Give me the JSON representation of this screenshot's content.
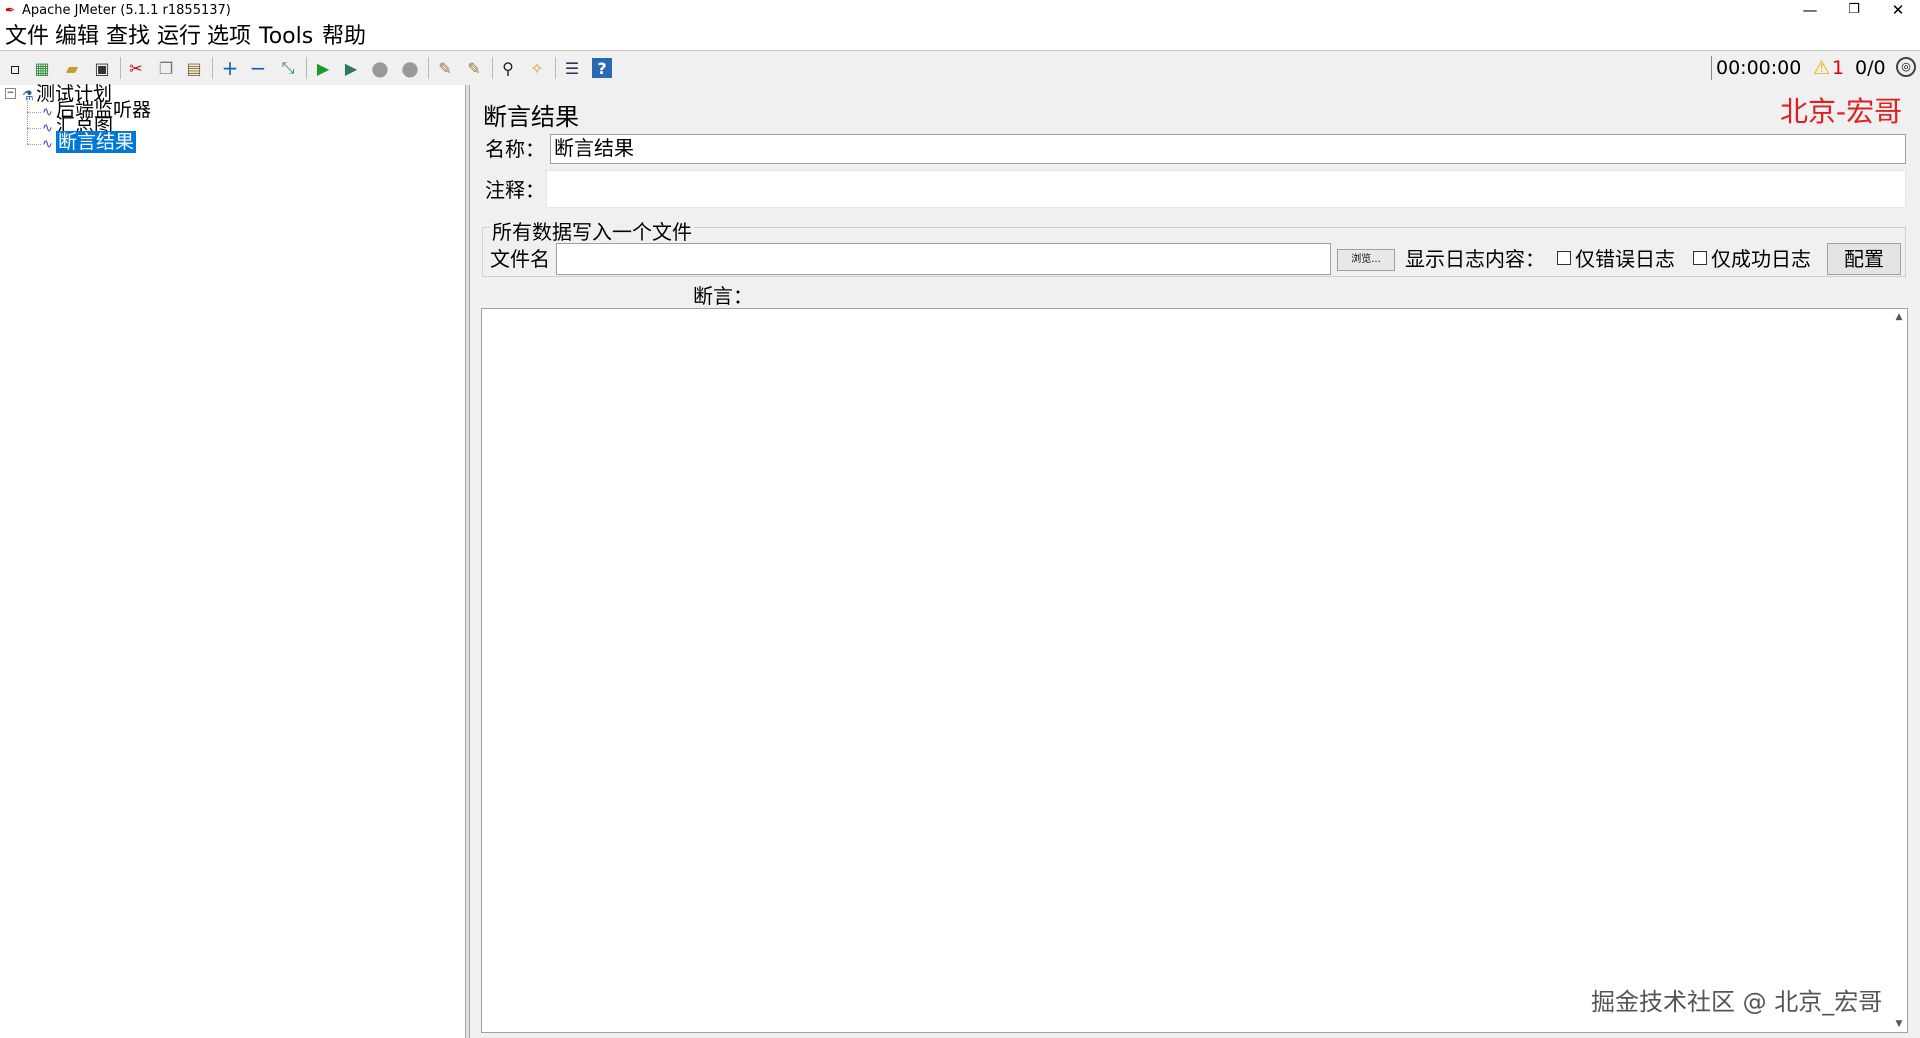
{
  "window": {
    "title": "Apache JMeter (5.1.1 r1855137)",
    "minimize_glyph": "—",
    "restore_glyph": "❐",
    "close_glyph": "✕"
  },
  "menu": [
    "文件",
    "编辑",
    "查找",
    "运行",
    "选项",
    "Tools",
    "帮助"
  ],
  "toolbar": {
    "icons": [
      {
        "name": "new-icon",
        "glyph": "▫"
      },
      {
        "name": "templates-icon",
        "glyph": "▦"
      },
      {
        "name": "open-icon",
        "glyph": "▰"
      },
      {
        "name": "save-icon",
        "glyph": "▣"
      },
      {
        "name": "cut-icon",
        "glyph": "✂"
      },
      {
        "name": "copy-icon",
        "glyph": "❐"
      },
      {
        "name": "paste-icon",
        "glyph": "▤"
      },
      {
        "name": "expand-icon",
        "glyph": "+"
      },
      {
        "name": "collapse-icon",
        "glyph": "−"
      },
      {
        "name": "toggle-icon",
        "glyph": "⤡"
      },
      {
        "name": "start-icon",
        "glyph": "▶"
      },
      {
        "name": "start-no-pause-icon",
        "glyph": "▶"
      },
      {
        "name": "stop-icon",
        "glyph": "●"
      },
      {
        "name": "shutdown-icon",
        "glyph": "●"
      },
      {
        "name": "clear-icon",
        "glyph": "✎"
      },
      {
        "name": "clear-all-icon",
        "glyph": "✎"
      },
      {
        "name": "search-icon",
        "glyph": "⚲"
      },
      {
        "name": "reset-search-icon",
        "glyph": "✧"
      },
      {
        "name": "function-helper-icon",
        "glyph": "☰"
      },
      {
        "name": "help-icon",
        "glyph": "?"
      }
    ],
    "timer": "00:00:00",
    "warning_glyph": "⚠",
    "warning_count": "1",
    "threads": "0/0",
    "globe_glyph": "◎"
  },
  "tree": {
    "expander": "−",
    "root": "测试计划",
    "children": [
      "后端监听器",
      "汇总图",
      "断言结果"
    ]
  },
  "panel": {
    "title": "断言结果",
    "name_label": "名称：",
    "name_value": "断言结果",
    "comment_label": "注释：",
    "comment_value": "",
    "file_group_title": "所有数据写入一个文件",
    "filename_label": "文件名",
    "filename_value": "",
    "browse_label": "浏览...",
    "log_label": "显示日志内容：",
    "errors_only_label": "仅错误日志",
    "success_only_label": "仅成功日志",
    "configure_label": "配置",
    "assertions_label": "断言："
  },
  "watermark_top": "北京-宏哥",
  "watermark_bottom": "掘金技术社区 @ 北京_宏哥",
  "colors": {
    "accent": "#0078d7",
    "watermark": "#e02020"
  }
}
